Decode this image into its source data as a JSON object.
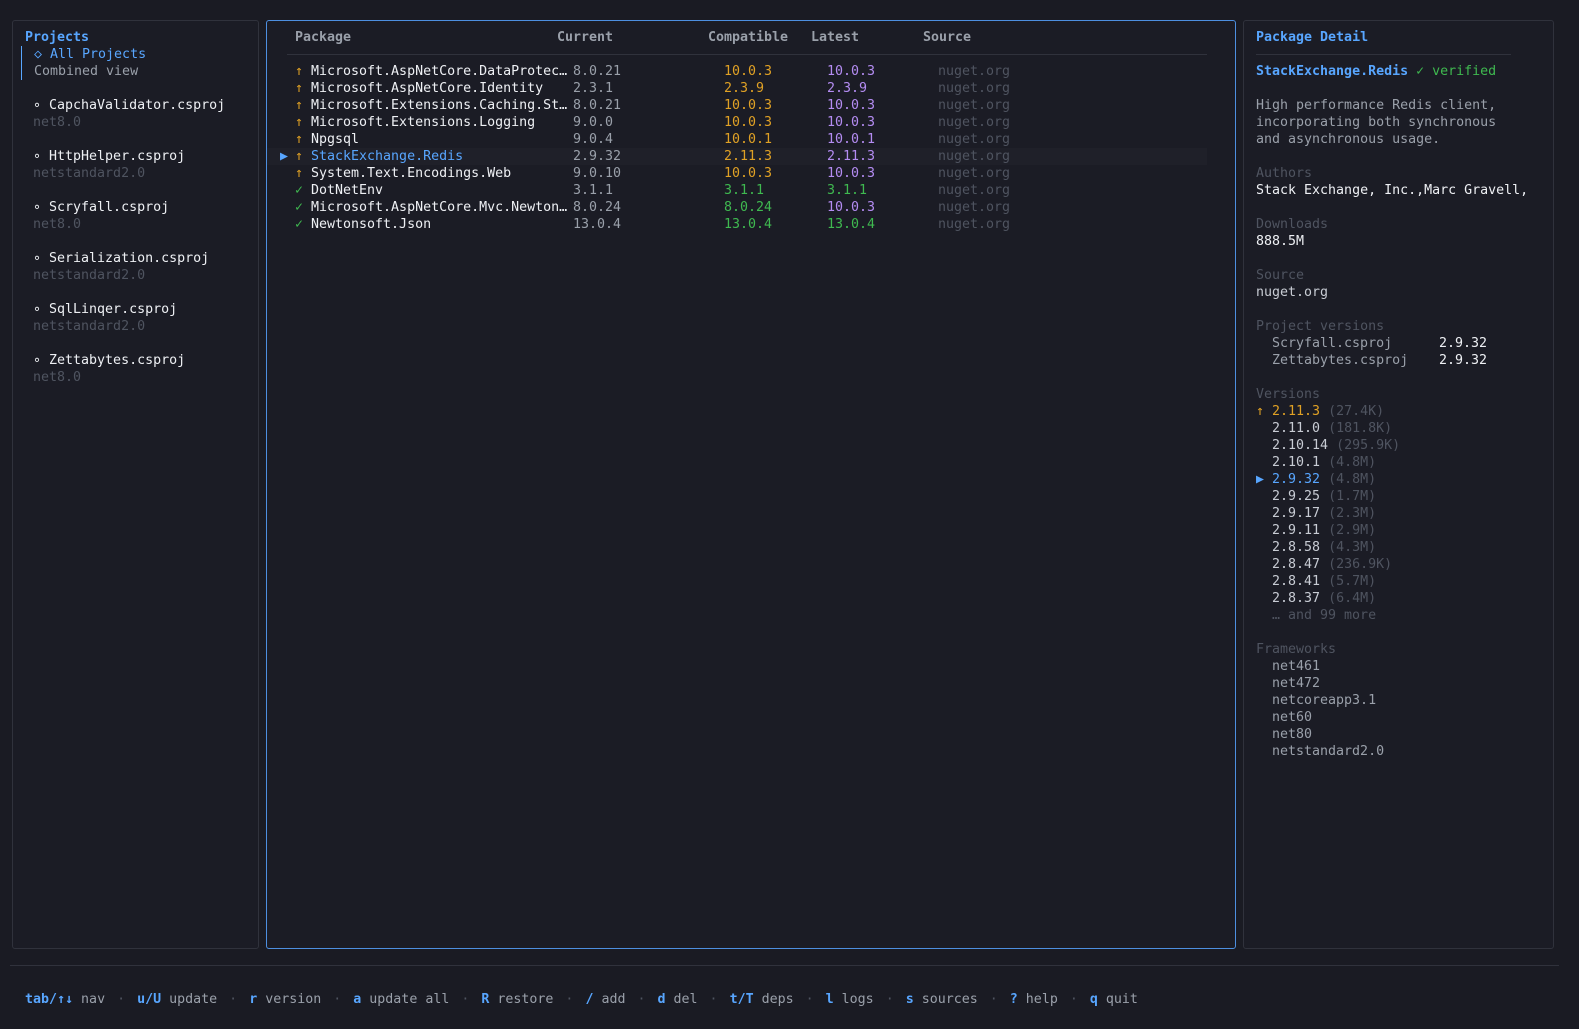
{
  "projects_panel": {
    "title": "Projects",
    "all_projects": "◇ All Projects",
    "combined_view": "Combined view",
    "projects": [
      {
        "name": "CapchaValidator.csproj",
        "framework": "net8.0"
      },
      {
        "name": "HttpHelper.csproj",
        "framework": "netstandard2.0"
      },
      {
        "name": "Scryfall.csproj",
        "framework": "net8.0"
      },
      {
        "name": "Serialization.csproj",
        "framework": "netstandard2.0"
      },
      {
        "name": "SqlLinqer.csproj",
        "framework": "netstandard2.0"
      },
      {
        "name": "Zettabytes.csproj",
        "framework": "net8.0"
      }
    ],
    "bullet": "∘"
  },
  "packages_table": {
    "headers": {
      "package": "Package",
      "current": "Current",
      "compatible": "Compatible",
      "latest": "Latest",
      "source": "Source"
    },
    "rows": [
      {
        "status": "outdated",
        "icon": "↑",
        "name": "Microsoft.AspNetCore.DataProtec…",
        "current": "8.0.21",
        "compatible": "10.0.3",
        "latest": "10.0.3",
        "source": "nuget.org"
      },
      {
        "status": "outdated",
        "icon": "↑",
        "name": "Microsoft.AspNetCore.Identity",
        "current": "2.3.1",
        "compatible": "2.3.9",
        "latest": "2.3.9",
        "source": "nuget.org"
      },
      {
        "status": "outdated",
        "icon": "↑",
        "name": "Microsoft.Extensions.Caching.St…",
        "current": "8.0.21",
        "compatible": "10.0.3",
        "latest": "10.0.3",
        "source": "nuget.org"
      },
      {
        "status": "outdated",
        "icon": "↑",
        "name": "Microsoft.Extensions.Logging",
        "current": "9.0.0",
        "compatible": "10.0.3",
        "latest": "10.0.3",
        "source": "nuget.org"
      },
      {
        "status": "outdated",
        "icon": "↑",
        "name": "Npgsql",
        "current": "9.0.4",
        "compatible": "10.0.1",
        "latest": "10.0.1",
        "source": "nuget.org"
      },
      {
        "status": "outdated",
        "icon": "↑",
        "name": "StackExchange.Redis",
        "current": "2.9.32",
        "compatible": "2.11.3",
        "latest": "2.11.3",
        "source": "nuget.org",
        "selected": true
      },
      {
        "status": "outdated",
        "icon": "↑",
        "name": "System.Text.Encodings.Web",
        "current": "9.0.10",
        "compatible": "10.0.3",
        "latest": "10.0.3",
        "source": "nuget.org"
      },
      {
        "status": "ok",
        "icon": "✓",
        "name": "DotNetEnv",
        "current": "3.1.1",
        "compatible": "3.1.1",
        "latest": "3.1.1",
        "source": "nuget.org",
        "latest_ok": true
      },
      {
        "status": "ok",
        "icon": "✓",
        "name": "Microsoft.AspNetCore.Mvc.Newton…",
        "current": "8.0.24",
        "compatible": "8.0.24",
        "latest": "10.0.3",
        "source": "nuget.org"
      },
      {
        "status": "ok",
        "icon": "✓",
        "name": "Newtonsoft.Json",
        "current": "13.0.4",
        "compatible": "13.0.4",
        "latest": "13.0.4",
        "source": "nuget.org",
        "latest_ok": true
      }
    ],
    "selected_marker": "▶"
  },
  "detail": {
    "title": "Package Detail",
    "package_name": "StackExchange.Redis",
    "verified": "✓ verified",
    "description": [
      "High performance Redis client,",
      "incorporating both synchronous",
      "and asynchronous usage."
    ],
    "authors_label": "Authors",
    "authors": "Stack Exchange, Inc.,Marc Gravell,",
    "downloads_label": "Downloads",
    "downloads": "888.5M",
    "source_label": "Source",
    "source": "nuget.org",
    "project_versions_label": "Project versions",
    "project_versions": [
      {
        "project": "Scryfall.csproj",
        "version": "2.9.32"
      },
      {
        "project": "Zettabytes.csproj",
        "version": "2.9.32"
      }
    ],
    "versions_label": "Versions",
    "versions": [
      {
        "marker": "↑",
        "version": "2.11.3",
        "downloads": "(27.4K)",
        "kind": "latest"
      },
      {
        "version": "2.11.0",
        "downloads": "(181.8K)"
      },
      {
        "version": "2.10.14",
        "downloads": "(295.9K)"
      },
      {
        "version": "2.10.1",
        "downloads": "(4.8M)"
      },
      {
        "marker": "▶",
        "version": "2.9.32",
        "downloads": "(4.8M)",
        "kind": "current"
      },
      {
        "version": "2.9.25",
        "downloads": "(1.7M)"
      },
      {
        "version": "2.9.17",
        "downloads": "(2.3M)"
      },
      {
        "version": "2.9.11",
        "downloads": "(2.9M)"
      },
      {
        "version": "2.8.58",
        "downloads": "(4.3M)"
      },
      {
        "version": "2.8.47",
        "downloads": "(236.9K)"
      },
      {
        "version": "2.8.41",
        "downloads": "(5.7M)"
      },
      {
        "version": "2.8.37",
        "downloads": "(6.4M)"
      }
    ],
    "more_versions": "… and 99 more",
    "frameworks_label": "Frameworks",
    "frameworks": [
      "net461",
      "net472",
      "netcoreapp3.1",
      "net60",
      "net80",
      "netstandard2.0"
    ]
  },
  "footer": {
    "shortcuts": [
      {
        "key": "tab/↑↓",
        "label": "nav"
      },
      {
        "key": "u/U",
        "label": "update"
      },
      {
        "key": "r",
        "label": "version"
      },
      {
        "key": "a",
        "label": "update all"
      },
      {
        "key": "R",
        "label": "restore"
      },
      {
        "key": "/",
        "label": "add"
      },
      {
        "key": "d",
        "label": "del"
      },
      {
        "key": "t/T",
        "label": "deps"
      },
      {
        "key": "l",
        "label": "logs"
      },
      {
        "key": "s",
        "label": "sources"
      },
      {
        "key": "?",
        "label": "help"
      },
      {
        "key": "q",
        "label": "quit"
      }
    ],
    "separator": "·"
  },
  "colors": {
    "accent": "#58a6ff",
    "outdated": "#e0a125",
    "latest": "#b48cf2",
    "ok": "#3fb950"
  }
}
